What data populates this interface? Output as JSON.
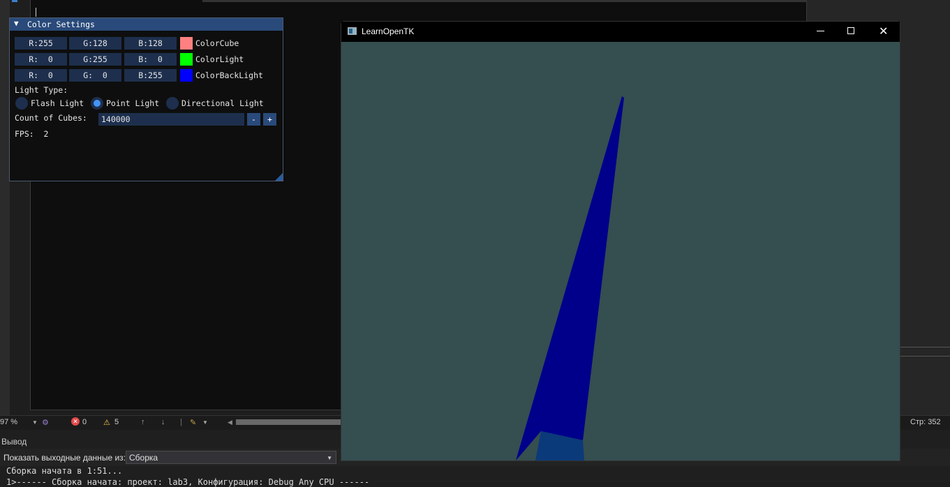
{
  "imgui": {
    "title": "Color Settings",
    "collapse_glyph": "▼",
    "rows": [
      {
        "r": "R:255",
        "g": "G:128",
        "b": "B:128",
        "swatch_color": "#ff8080",
        "label": "ColorCube"
      },
      {
        "r": "R:  0",
        "g": "G:255",
        "b": "B:  0",
        "swatch_color": "#00ff00",
        "label": "ColorLight"
      },
      {
        "r": "R:  0",
        "g": "G:  0",
        "b": "B:255",
        "swatch_color": "#0000ff",
        "label": "ColorBackLight"
      }
    ],
    "light_type_label": "Light Type:",
    "light_types": [
      {
        "label": "Flash Light",
        "selected": false
      },
      {
        "label": "Point Light",
        "selected": true
      },
      {
        "label": "Directional Light",
        "selected": false
      }
    ],
    "count_label": "Count of Cubes:",
    "count_value": "140000",
    "minus_label": "-",
    "plus_label": "+",
    "fps_label": "FPS:  2"
  },
  "tk_window": {
    "title": "LearnOpenTK",
    "close_glyph": "✕",
    "background_color": "#354e50",
    "shape_color": "#00008b"
  },
  "status_bar": {
    "zoom": "97 %",
    "errors": "0",
    "warnings": "5",
    "line": "Стр: 352"
  },
  "output": {
    "title": "Вывод",
    "show_label": "Показать выходные данные из:",
    "source": "Сборка",
    "line1": "Сборка начата в 1:51...",
    "line2": "1>------ Сборка начата: проект: lab3, Конфигурация: Debug Any CPU ------"
  }
}
